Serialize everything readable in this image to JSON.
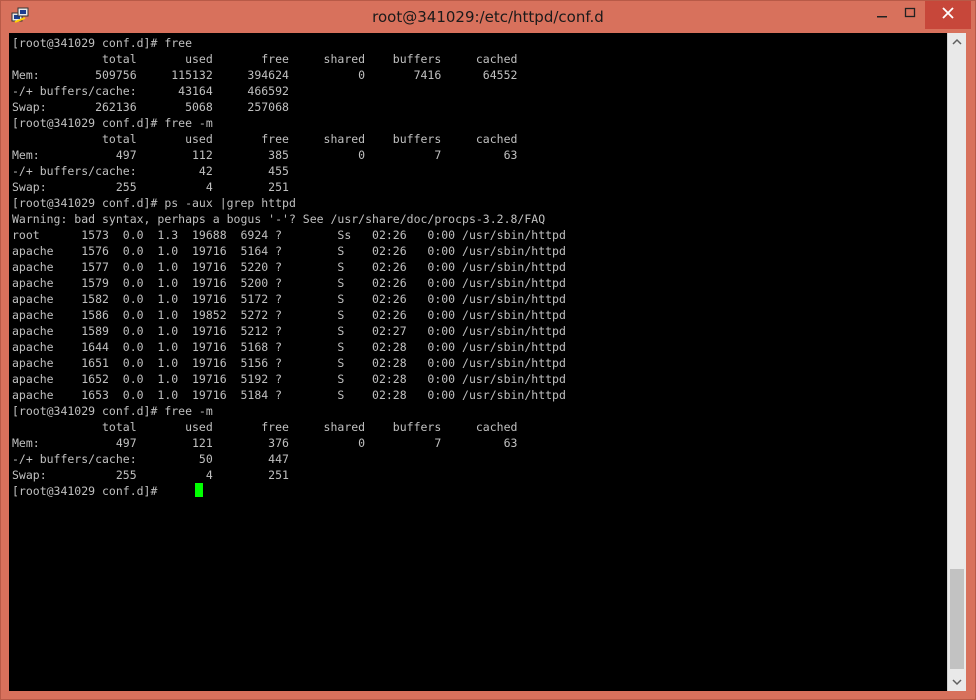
{
  "window": {
    "title": "root@341029:/etc/httpd/conf.d"
  },
  "colors": {
    "titlebar": "#d8715c",
    "terminal_bg": "#000000",
    "terminal_fg": "#c0c0c0",
    "cursor": "#00ff00"
  },
  "icons": {
    "app": "putty-icon",
    "minimize": "minimize-icon",
    "maximize": "maximize-icon",
    "close": "close-icon",
    "scroll_up": "scroll-up-arrow-icon",
    "scroll_down": "scroll-down-arrow-icon"
  },
  "terminal": {
    "lines": [
      "[root@341029 conf.d]# free",
      "             total       used       free     shared    buffers     cached",
      "Mem:        509756     115132     394624          0       7416      64552",
      "-/+ buffers/cache:      43164     466592",
      "Swap:       262136       5068     257068",
      "[root@341029 conf.d]# free -m",
      "             total       used       free     shared    buffers     cached",
      "Mem:           497        112        385          0          7         63",
      "-/+ buffers/cache:         42        455",
      "Swap:          255          4        251",
      "[root@341029 conf.d]# ps -aux |grep httpd",
      "Warning: bad syntax, perhaps a bogus '-'? See /usr/share/doc/procps-3.2.8/FAQ",
      "root      1573  0.0  1.3  19688  6924 ?        Ss   02:26   0:00 /usr/sbin/httpd",
      "apache    1576  0.0  1.0  19716  5164 ?        S    02:26   0:00 /usr/sbin/httpd",
      "apache    1577  0.0  1.0  19716  5220 ?        S    02:26   0:00 /usr/sbin/httpd",
      "apache    1579  0.0  1.0  19716  5200 ?        S    02:26   0:00 /usr/sbin/httpd",
      "apache    1582  0.0  1.0  19716  5172 ?        S    02:26   0:00 /usr/sbin/httpd",
      "apache    1586  0.0  1.0  19852  5272 ?        S    02:26   0:00 /usr/sbin/httpd",
      "apache    1589  0.0  1.0  19716  5212 ?        S    02:27   0:00 /usr/sbin/httpd",
      "apache    1644  0.0  1.0  19716  5168 ?        S    02:28   0:00 /usr/sbin/httpd",
      "apache    1651  0.0  1.0  19716  5156 ?        S    02:28   0:00 /usr/sbin/httpd",
      "apache    1652  0.0  1.0  19716  5192 ?        S    02:28   0:00 /usr/sbin/httpd",
      "apache    1653  0.0  1.0  19716  5184 ?        S    02:28   0:00 /usr/sbin/httpd",
      "[root@341029 conf.d]# free -m",
      "             total       used       free     shared    buffers     cached",
      "Mem:           497        121        376          0          7         63",
      "-/+ buffers/cache:         50        447",
      "Swap:          255          4        251",
      "[root@341029 conf.d]# "
    ]
  }
}
